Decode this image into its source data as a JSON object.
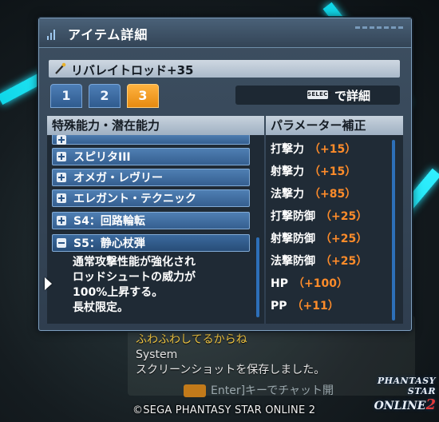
{
  "window": {
    "title": "アイテム詳細"
  },
  "item": {
    "name": "リバレイトロッド+35"
  },
  "tabs": [
    {
      "label": "1",
      "active": false
    },
    {
      "label": "2",
      "active": false
    },
    {
      "label": "3",
      "active": true
    }
  ],
  "detail": {
    "key_label": "SELECT",
    "text": "で詳細"
  },
  "abilities": {
    "header": "特殊能力・潜在能力",
    "items": [
      {
        "label": "スピリタIII",
        "expanded": false
      },
      {
        "label": "オメガ・レヴリー",
        "expanded": false
      },
      {
        "label": "エレガント・テクニック",
        "expanded": false
      },
      {
        "label": "S4：回路輪転",
        "expanded": false
      },
      {
        "label": "S5：静心杖弾",
        "expanded": true
      }
    ],
    "description_lines": [
      "通常攻撃性能が強化され",
      "ロッドシュートの威力が",
      "100%上昇する。",
      "長杖限定。"
    ]
  },
  "parameters": {
    "header": "パラメーター補正",
    "rows": [
      {
        "label": "打撃力",
        "value": "（+15）"
      },
      {
        "label": "射撃力",
        "value": "（+15）"
      },
      {
        "label": "法撃力",
        "value": "（+85）"
      },
      {
        "label": "打撃防御",
        "value": "（+25）"
      },
      {
        "label": "射撃防御",
        "value": "（+25）"
      },
      {
        "label": "法撃防御",
        "value": "（+25）"
      },
      {
        "label": "HP",
        "value": "（+100）"
      },
      {
        "label": "PP",
        "value": "（+11）"
      }
    ]
  },
  "chat": {
    "player_line": "ふわふわしてるからね",
    "system_label": "System",
    "system_message": "スクリーンショットを保存しました。",
    "input_hint": "Enter]キーでチャット開"
  },
  "copyright": "©SEGA PHANTASY STAR ONLINE 2",
  "logo": {
    "line1": "PHANTASY STAR",
    "line2": "ONLINE",
    "number": "2"
  },
  "colors": {
    "accent": "#22e6ff",
    "tab_active": "#f39a1e",
    "param_value": "#ff8c2a"
  }
}
